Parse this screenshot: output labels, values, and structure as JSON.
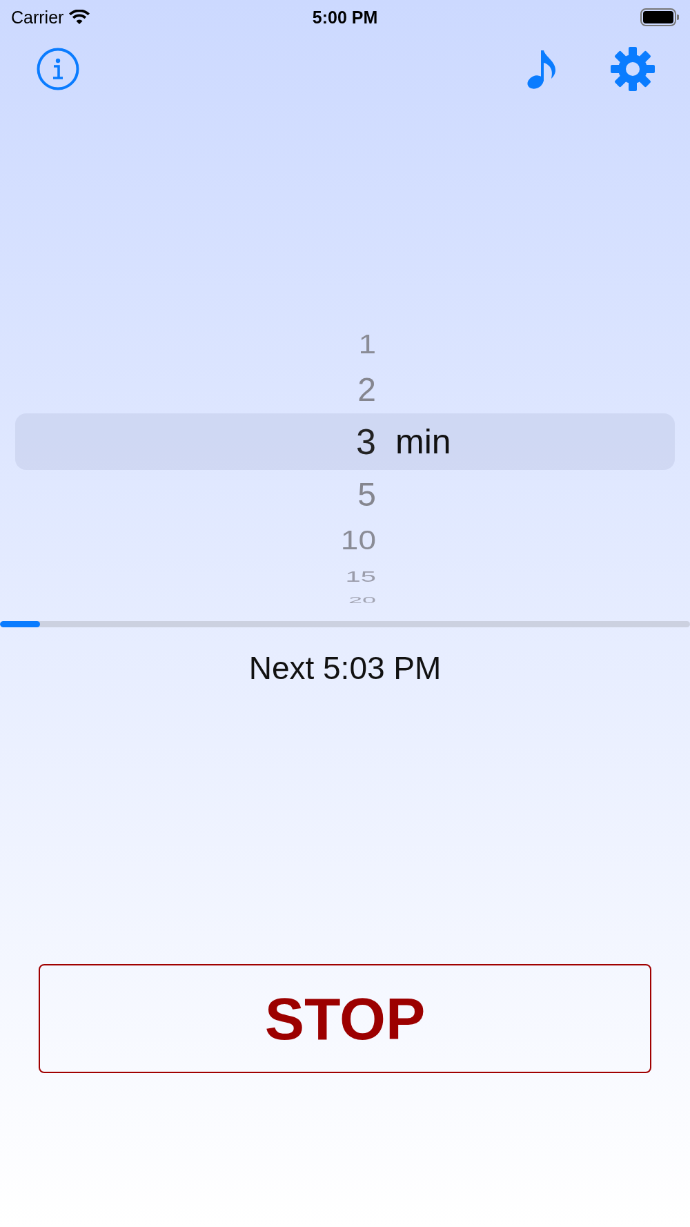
{
  "status_bar": {
    "carrier": "Carrier",
    "time": "5:00 PM"
  },
  "picker": {
    "unit": "min",
    "items": [
      {
        "value": "1",
        "selected": false
      },
      {
        "value": "2",
        "selected": false
      },
      {
        "value": "3",
        "selected": true
      },
      {
        "value": "5",
        "selected": false
      },
      {
        "value": "10",
        "selected": false
      },
      {
        "value": "15",
        "selected": false
      },
      {
        "value": "20",
        "selected": false
      }
    ]
  },
  "progress": {
    "level": 0.058
  },
  "next_label": "Next 5:03 PM",
  "stop_button": "STOP"
}
